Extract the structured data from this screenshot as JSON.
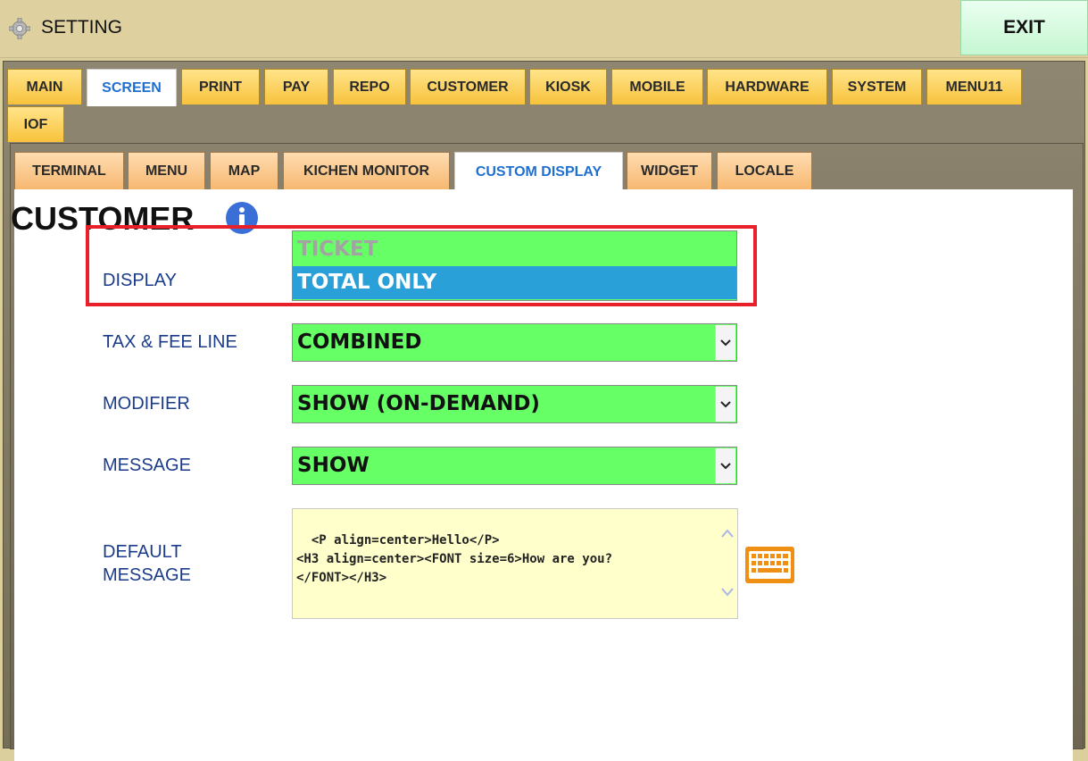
{
  "window": {
    "title": "SETTING",
    "exit_label": "EXIT"
  },
  "main_tabs": [
    {
      "label": "MAIN",
      "active": false
    },
    {
      "label": "SCREEN",
      "active": true
    },
    {
      "label": "PRINT",
      "active": false
    },
    {
      "label": "PAY",
      "active": false
    },
    {
      "label": "REPO",
      "active": false
    },
    {
      "label": "CUSTOMER",
      "active": false
    },
    {
      "label": "KIOSK",
      "active": false
    },
    {
      "label": "MOBILE",
      "active": false
    },
    {
      "label": "HARDWARE",
      "active": false
    },
    {
      "label": "SYSTEM",
      "active": false
    },
    {
      "label": "MENU11",
      "active": false
    },
    {
      "label": "IOF",
      "active": false
    }
  ],
  "sub_tabs": [
    {
      "label": "TERMINAL",
      "active": false
    },
    {
      "label": "MENU",
      "active": false
    },
    {
      "label": "MAP",
      "active": false
    },
    {
      "label": "KICHEN MONITOR",
      "active": false
    },
    {
      "label": "CUSTOM DISPLAY",
      "active": true
    },
    {
      "label": "WIDGET",
      "active": false
    },
    {
      "label": "LOCALE",
      "active": false
    }
  ],
  "page": {
    "title": "CUSTOMER"
  },
  "fields": {
    "display": {
      "label": "DISPLAY",
      "options": [
        "TICKET",
        "TOTAL ONLY"
      ],
      "selected": "TOTAL ONLY"
    },
    "tax_fee_line": {
      "label": "TAX & FEE LINE",
      "value": "COMBINED"
    },
    "modifier": {
      "label": "MODIFIER",
      "value": "SHOW (ON-DEMAND)"
    },
    "message": {
      "label": "MESSAGE",
      "value": "SHOW"
    },
    "default_message": {
      "label_line1": "DEFAULT",
      "label_line2": "MESSAGE",
      "value": "<P align=center>Hello</P>\n<H3 align=center><FONT size=6>How are you?\n</FONT></H3>"
    }
  },
  "colors": {
    "select_bg": "#66ff66",
    "highlight_border": "#e8202a",
    "selected_option_bg": "#2aa0d8",
    "label_text": "#1b3c8c"
  }
}
